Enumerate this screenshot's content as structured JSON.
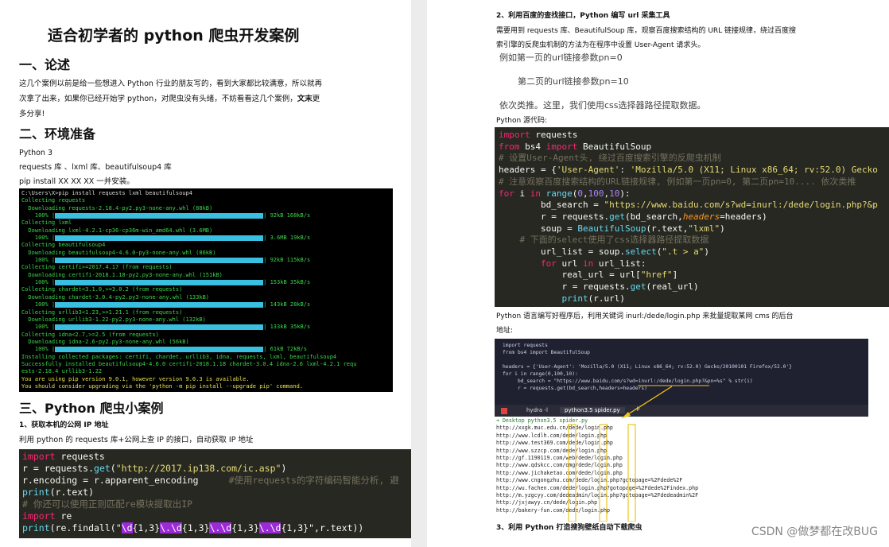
{
  "left": {
    "title": "适合初学者的 python 爬虫开发案例",
    "section1": "一、论述",
    "para1_line1": "这几个案例以前是给一些想进入 Python 行业的朋友写的，看到大家都比较满意，所以就再",
    "para1_line2a": "次拿了出来，如果你已经开始学 python，对爬虫没有头绪，不妨看看这几个案例，",
    "para1_line2b": "文末",
    "para1_line2c": "更",
    "para1_line3": "多分享!",
    "section2": "二、环境准备",
    "env1": "Python 3",
    "env2": "requests 库 、lxml 库、beautifulsoup4 库",
    "env3": "pip install XX XX XX 一并安装。",
    "terminal": [
      "C:\\Users\\X>pip install requests lxml beautifulsoup4",
      "Collecting requests",
      "  Downloading requests-2.18.4-py2.py3-none-any.whl (88kB)",
      "    100% |@@| 92kB 168kB/s",
      "Collecting lxml",
      "  Downloading lxml-4.2.1-cp36-cp36m-win_amd64.whl (3.6MB)",
      "    100% |@@| 3.6MB 19kB/s",
      "Collecting beautifulsoup4",
      "  Downloading beautifulsoup4-4.6.0-py3-none-any.whl (86kB)",
      "    100% |@@| 92kB 115kB/s",
      "Collecting certifi>=2017.4.17 (from requests)",
      "  Downloading certifi-2018.1.18-py2.py3-none-any.whl (151kB)",
      "    100% |@@| 153kB 35kB/s",
      "Collecting chardet<3.1.0,>=3.0.2 (from requests)",
      "  Downloading chardet-3.0.4-py2.py3-none-any.whl (133kB)",
      "    100% |@@| 143kB 28kB/s",
      "Collecting urllib3<1.23,>=1.21.1 (from requests)",
      "  Downloading urllib3-1.22-py2.py3-none-any.whl (132kB)",
      "    100% |@@| 133kB 35kB/s",
      "Collecting idna<2.7,>=2.5 (from requests)",
      "  Downloading idna-2.6-py2.py3-none-any.whl (56kB)",
      "    100% |@@| 61kB 72kB/s",
      "Installing collected packages: certifi, chardet, urllib3, idna, requests, lxml, beautifulsoup4",
      "Successfully installed beautifulsoup4-4.6.0 certifi-2018.1.18 chardet-3.0.4 idna-2.6 lxml-4.2.1 requ",
      "ests-2.18.4 urllib3-1.22",
      "You are using pip version 9.0.1, however version 9.0.3 is available.",
      "You should consider upgrading via the 'python -m pip install --upgrade pip' command."
    ],
    "section3": "三、Python 爬虫小案例",
    "sub1": "1、获取本机的公网 IP 地址",
    "sub1_desc": "利用 python 的 requests 库+公网上查 IP 的接口，自动获取 IP 地址",
    "code1": {
      "l1_kw": "import",
      "l1_rest": " requests",
      "l2_a": "r = requests.",
      "l2_fn": "get",
      "l2_b": "(",
      "l2_str": "\"http://2017.ip138.com/ic.asp\"",
      "l2_c": ")",
      "l3_a": "r.encoding = r.apparent_encoding",
      "l3_cm": "#使用requests的字符编码智能分析, 避",
      "l4_fn": "print",
      "l4_rest": "(r.text)",
      "l5_cm": "# 你还可以使用正则匹配re模块提取出IP",
      "l6_kw": "import",
      "l6_rest": " re",
      "l7_fn": "print",
      "l7_a": "(re.findall(\"",
      "l7_h1": "\\d",
      "l7_b": "{1,3}",
      "l7_h2": "\\.\\d",
      "l7_c": "{1,3}",
      "l7_h3": "\\.\\d",
      "l7_d": "{1,3}",
      "l7_h4": "\\.\\d",
      "l7_e": "{1,3}\",r.text))"
    }
  },
  "right": {
    "heading2": "2、利用百度的查找接口，Python 编写 url 采集工具",
    "desc_line1": "需要用到 requests 库、BeautifulSoup 库，观察百度搜索结构的 URL 链接规律，绕过百度搜",
    "desc_line2": "索引擎的反爬虫机制的方法为在程序中设置 User-Agent 请求头。",
    "note1": "例如第一页的url链接参数pn=0",
    "note2": "第二页的url链接参数pn=10",
    "note3": "依次类推。这里，我们使用css选择器路径提取数据。",
    "src_label": "Python 源代码:",
    "code2": {
      "l1_kw": "import",
      "l1_rest": " requests",
      "l2_kw1": "from",
      "l2_a": " bs4 ",
      "l2_kw2": "import",
      "l2_b": " BeautifulSoup",
      "l3_cm": "# 设置User-Agent头, 绕过百度搜索引擎的反爬虫机制",
      "l4_a": "headers = {",
      "l4_s1": "'User-Agent'",
      "l4_b": ": ",
      "l4_s2": "'Mozilla/5.0 (X11; Linux x86_64; rv:52.0) Gecko",
      "l5_cm": "# 注意观察百度搜索结构的URL链接规律, 例如第一页pn=0, 第二页pn=10.... 依次类推",
      "l6_kw1": "for",
      "l6_a": " i ",
      "l6_kw2": "in",
      "l6_fn": " range",
      "l6_b": "(",
      "l6_n1": "0",
      "l6_c": ",",
      "l6_n2": "100",
      "l6_d": ",",
      "l6_n3": "10",
      "l6_e": "):",
      "l7_a": "        bd_search = ",
      "l7_s": "\"https://www.baidu.com/s?wd=inurl:/dede/login.php?&p",
      "l8_a": "        r = requests.",
      "l8_fn": "get",
      "l8_b": "(bd_search,",
      "l8_ar": "headers",
      "l8_c": "=headers)",
      "l9_a": "        soup = ",
      "l9_fn": "BeautifulSoup",
      "l9_b": "(r.text,",
      "l9_s": "\"lxml\"",
      "l9_c": ")",
      "l10_cm": "    # 下面的select使用了css选择器路径提取数据",
      "l11_a": "        url_list = soup.",
      "l11_fn": "select",
      "l11_b": "(",
      "l11_s": "\".t > a\"",
      "l11_c": ")",
      "l12_kw1": "        for",
      "l12_a": " url ",
      "l12_kw2": "in",
      "l12_b": " url_list:",
      "l13_a": "            real_url = url[",
      "l13_s": "\"href\"",
      "l13_b": "]",
      "l14_a": "            r = requests.",
      "l14_fn": "get",
      "l14_b": "(real_url)",
      "l15_fn": "            print",
      "l15_b": "(r.url)"
    },
    "after_line1": "Python 语言编写好程序后，利用关键词 inurl:/dede/login.php 来批量提取某网 cms 的后台",
    "after_line2": "地址:",
    "screenshot": {
      "editor": [
        "import requests",
        "from bs4 import BeautifulSoup",
        "",
        "headers = {'User-Agent': 'Mozilla/5.0 (X11; Linux x86_64; rv:52.0) Gecko/20100101 Firefox/52.0'}",
        "for i in range(0,100,10):",
        "     bd_search = \"https://www.baidu.com/s?wd=inurl:/dede/login.php?&pn=%s\" % str(i)",
        "     r = requests.get(bd_search,headers=headers)"
      ],
      "tab1": "hydra -l",
      "tab2": "python3.5 spider.py",
      "tab_plus": "+",
      "prompt": "➜ Desktop python3.5 spider.py",
      "out": [
        "http://xxgk.muc.edu.cn/dede/login.php",
        "http://www.lcdlh.com/dede/login.php",
        "http://www.test369.com/dede/login.php",
        "http://www.szzcp.com/dede/login.php",
        "http://gf.1190119.com/web/dede/login.php",
        "http://www.qdskcc.com/omg/dede/login.php",
        "http://www.jichaketao.com/dede/login.php",
        "http://www.cngongzhu.com/dede/login.php?gotopage=%2Fdede%2F",
        "http://wu.fachen.com/dede/login.php?gotopage=%2Fdede%2Findex.php",
        "http://m.yzgcyy.com/dedeadmin/login.php?gotopage=%2Fdedeadmin%2F",
        "http://jxjawyy.cn/dede/login.php",
        "http://bakery-fun.com/dede/login.php"
      ]
    },
    "heading3": "3、利用 Python 打造搜狗壁纸自动下载爬虫",
    "watermark": "CSDN @做梦都在改BUG"
  }
}
